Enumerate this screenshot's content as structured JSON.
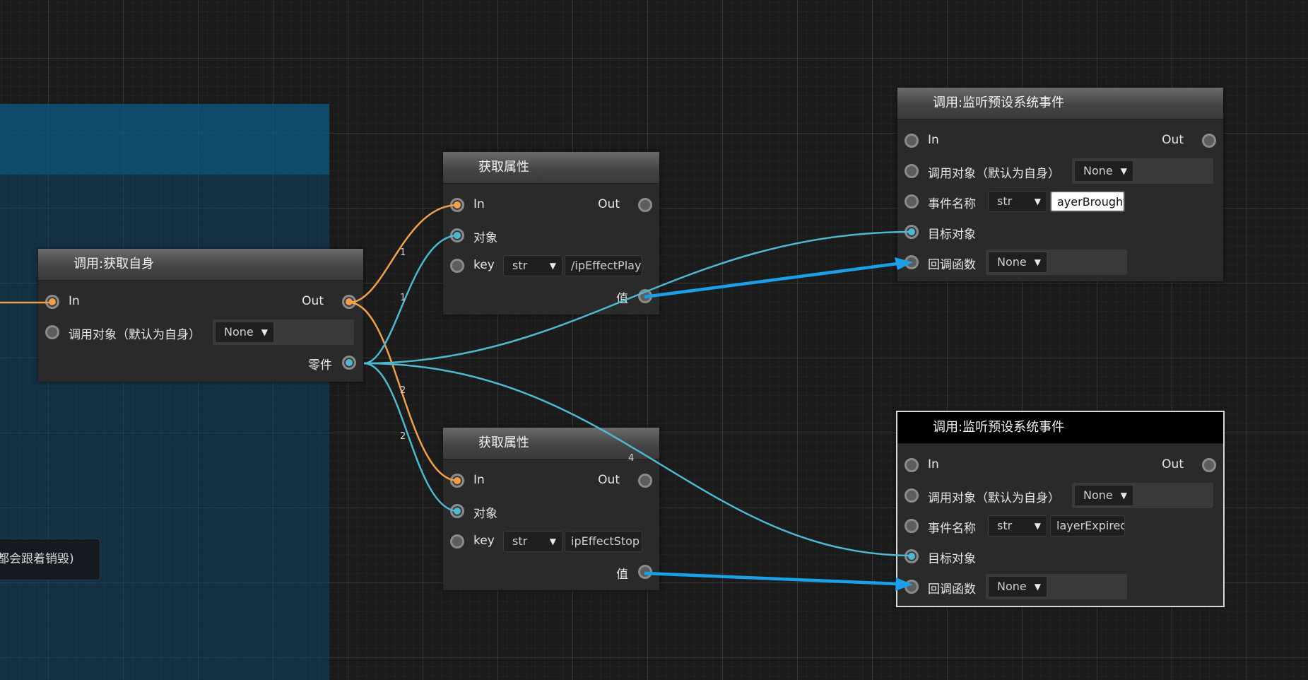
{
  "colors": {
    "exec_wire": "#f0a04a",
    "data_wire": "#4fb8d0",
    "callback_wire": "#1a9fe8",
    "group_fill": "#0a5078"
  },
  "comment": {
    "text": "都会跟着销毁)"
  },
  "wire_labels": [
    "1",
    "1",
    "2",
    "2",
    "4"
  ],
  "nodes": {
    "get_self": {
      "title": "调用:获取自身",
      "in_label": "In",
      "out_label": "Out",
      "caller_label": "调用对象（默认为自身）",
      "caller_value": "None",
      "component_label": "零件"
    },
    "get_prop_1": {
      "title": "获取属性",
      "in_label": "In",
      "out_label": "Out",
      "object_label": "对象",
      "key_label": "key",
      "key_type": "str",
      "key_value": "/ipEffectPlay",
      "value_label": "值"
    },
    "get_prop_2": {
      "title": "获取属性",
      "in_label": "In",
      "out_label": "Out",
      "object_label": "对象",
      "key_label": "key",
      "key_type": "str",
      "key_value": "ipEffectStop",
      "value_label": "值"
    },
    "listen_1": {
      "title": "调用:监听预设系统事件",
      "in_label": "In",
      "out_label": "Out",
      "caller_label": "调用对象（默认为自身）",
      "caller_value": "None",
      "event_label": "事件名称",
      "event_type": "str",
      "event_value": "ayerBrought",
      "target_label": "目标对象",
      "callback_label": "回调函数",
      "callback_value": "None"
    },
    "listen_2": {
      "title": "调用:监听预设系统事件",
      "in_label": "In",
      "out_label": "Out",
      "caller_label": "调用对象（默认为自身）",
      "caller_value": "None",
      "event_label": "事件名称",
      "event_type": "str",
      "event_value": "layerExpired",
      "target_label": "目标对象",
      "callback_label": "回调函数",
      "callback_value": "None"
    }
  }
}
